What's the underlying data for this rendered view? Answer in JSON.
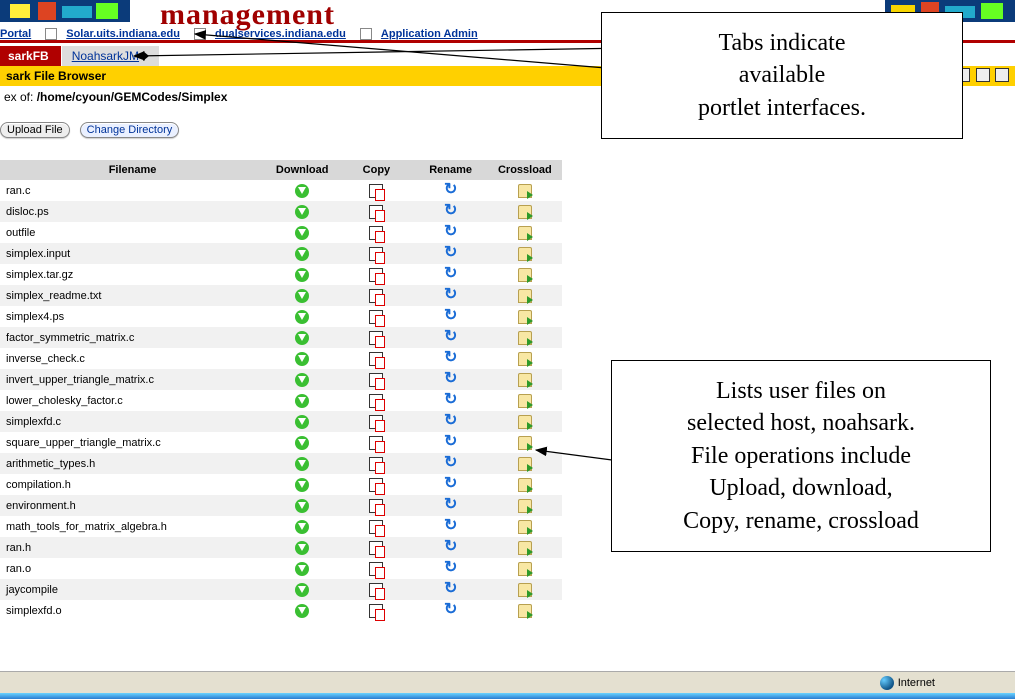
{
  "overlay_title": "management",
  "top_links": {
    "portal": "Portal",
    "solar": "Solar.uits.indiana.edu",
    "dual": "dualservices.indiana.edu",
    "appadmin": "Application Admin"
  },
  "tabs2": {
    "active": "sarkFB",
    "inactive": "NoahsarkJM"
  },
  "portlet_title": "sark File Browser",
  "path_label": "ex of: ",
  "path_value": "/home/cyoun/GEMCodes/Simplex",
  "buttons": {
    "upload": "Upload File",
    "changedir": "Change Directory"
  },
  "columns": {
    "filename": "Filename",
    "download": "Download",
    "copy": "Copy",
    "rename": "Rename",
    "crossload": "Crossload"
  },
  "files": [
    "ran.c",
    "disloc.ps",
    "outfile",
    "simplex.input",
    "simplex.tar.gz",
    "simplex_readme.txt",
    "simplex4.ps",
    "factor_symmetric_matrix.c",
    "inverse_check.c",
    "invert_upper_triangle_matrix.c",
    "lower_cholesky_factor.c",
    "simplexfd.c",
    "square_upper_triangle_matrix.c",
    "arithmetic_types.h",
    "compilation.h",
    "environment.h",
    "math_tools_for_matrix_algebra.h",
    "ran.h",
    "ran.o",
    "jaycompile",
    "simplexfd.o"
  ],
  "callout1_lines": [
    "Tabs indicate",
    "available",
    "portlet interfaces."
  ],
  "callout2_lines": [
    "Lists user files on",
    "selected host, noahsark.",
    "File operations include",
    "Upload, download,",
    "Copy, rename, crossload"
  ],
  "status_text": "Internet"
}
